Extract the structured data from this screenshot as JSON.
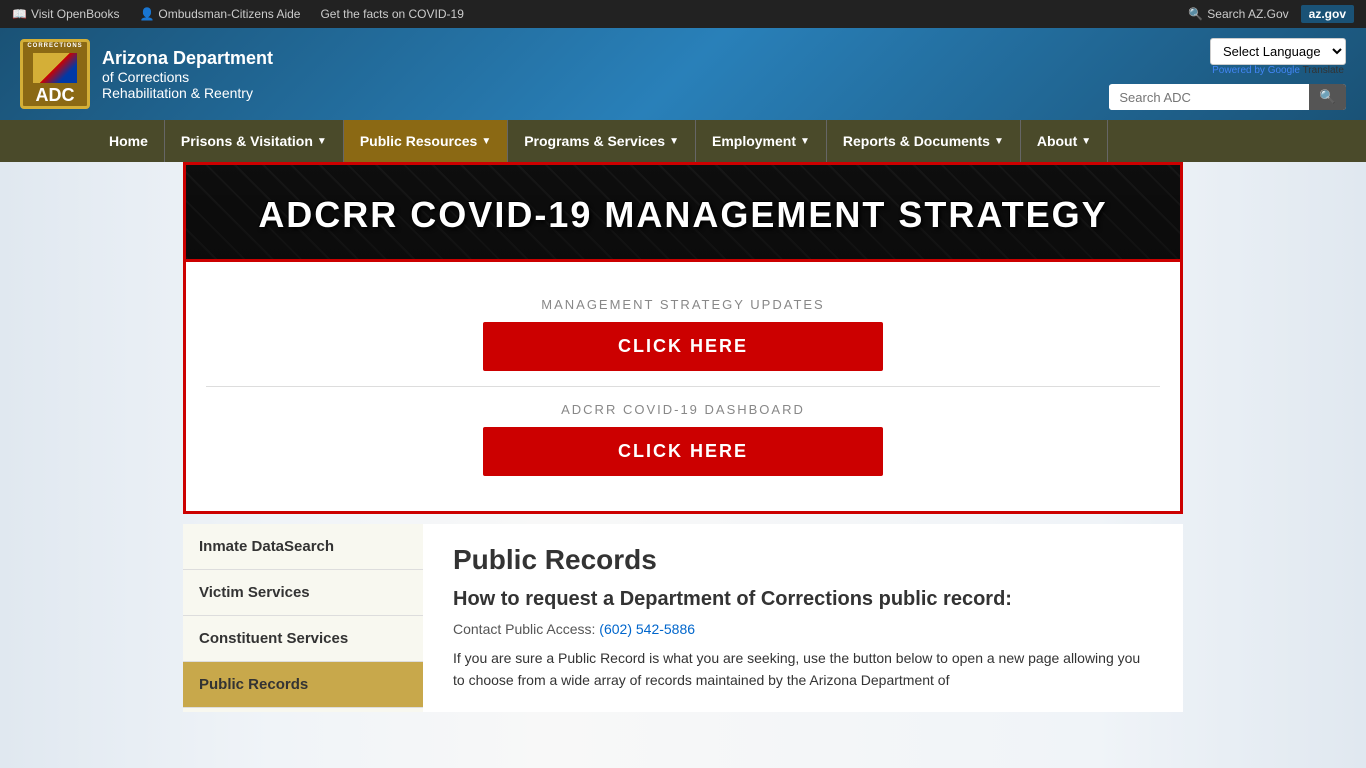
{
  "topbar": {
    "links": [
      {
        "label": "Visit OpenBooks",
        "icon": "book-icon"
      },
      {
        "label": "Ombudsman-Citizens Aide",
        "icon": "person-icon"
      },
      {
        "label": "Get the facts on COVID-19",
        "icon": ""
      }
    ],
    "right": {
      "search_label": "Search AZ.Gov",
      "az_gov": "az.gov"
    }
  },
  "header": {
    "logo": {
      "corrections_text": "CORRECTIONS",
      "adc_label": "ADC"
    },
    "agency": {
      "line1": "Arizona Department",
      "line2": "of Corrections",
      "line3": "Rehabilitation & Reentry"
    },
    "language": {
      "label": "Select Language",
      "powered_by": "Powered by",
      "google": "Google",
      "translate": "Translate"
    },
    "search": {
      "placeholder": "Search ADC"
    }
  },
  "nav": {
    "items": [
      {
        "label": "Home",
        "active": false,
        "has_arrow": false
      },
      {
        "label": "Prisons & Visitation",
        "active": false,
        "has_arrow": true
      },
      {
        "label": "Public Resources",
        "active": true,
        "has_arrow": true
      },
      {
        "label": "Programs & Services",
        "active": false,
        "has_arrow": true
      },
      {
        "label": "Employment",
        "active": false,
        "has_arrow": true
      },
      {
        "label": "Reports & Documents",
        "active": false,
        "has_arrow": true
      },
      {
        "label": "About",
        "active": false,
        "has_arrow": true
      }
    ]
  },
  "covid": {
    "banner_title": "ADCRR COVID-19 MANAGEMENT STRATEGY",
    "section1_label": "MANAGEMENT STRATEGY UPDATES",
    "section1_btn": "CLICK HERE",
    "section2_label": "ADCRR COVID-19 DASHBOARD",
    "section2_btn": "CLICK HERE"
  },
  "sidebar": {
    "items": [
      {
        "label": "Inmate DataSearch",
        "active": false
      },
      {
        "label": "Victim Services",
        "active": false
      },
      {
        "label": "Constituent Services",
        "active": false
      },
      {
        "label": "Public Records",
        "active": true
      }
    ]
  },
  "content": {
    "title": "Public Records",
    "subtitle": "How to request a Department of Corrections public record:",
    "contact_label": "Contact Public Access:",
    "contact_phone": "(602) 542-5886",
    "description": "If you are sure a Public Record is what you are seeking, use the button below to open a new page allowing you to choose from a wide array of records maintained by the Arizona Department of"
  }
}
